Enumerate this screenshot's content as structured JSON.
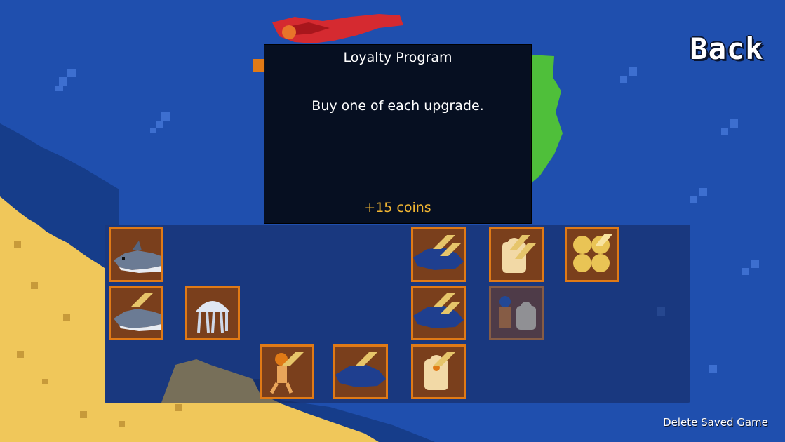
{
  "screen": "achievements",
  "buttons": {
    "back_label": "Back",
    "delete_label": "Delete Saved Game"
  },
  "tooltip": {
    "title": "Loyalty Program",
    "description": "Buy one of each upgrade.",
    "reward": "+15 coins"
  },
  "achievement_tiles": [
    {
      "icon": "shark-icon",
      "state": "unlocked",
      "tiered": false
    },
    {
      "icon": "whale-icon",
      "state": "unlocked",
      "tiered": true
    },
    {
      "icon": "diver-suit-icon",
      "state": "unlocked",
      "tiered": true
    },
    {
      "icon": "coins-icon",
      "state": "unlocked",
      "tiered": true
    },
    {
      "icon": "shark-icon",
      "state": "unlocked",
      "tiered": true
    },
    {
      "icon": "jellyfish-icon",
      "state": "unlocked",
      "tiered": false
    },
    {
      "icon": "whale-icon",
      "state": "unlocked",
      "tiered": true
    },
    {
      "icon": "diver-pair-icon",
      "state": "selected",
      "tiered": false
    },
    {
      "icon": "diver-icon",
      "state": "unlocked",
      "tiered": true
    },
    {
      "icon": "whale-icon",
      "state": "unlocked",
      "tiered": true
    },
    {
      "icon": "diver-suit-icon",
      "state": "unlocked",
      "tiered": true
    }
  ],
  "colors": {
    "ocean": "#1f4fae",
    "sand": "#f0c75a",
    "tile_border": "#e07a16",
    "tile_fill": "#7a3f1c",
    "reward_text": "#f2b632"
  }
}
